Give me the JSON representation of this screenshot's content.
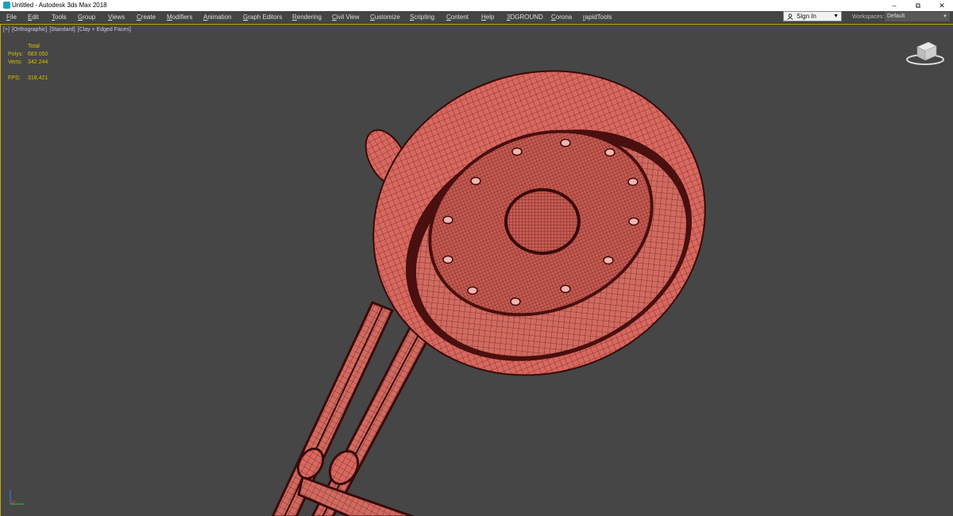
{
  "window": {
    "title": "Untitled - Autodesk 3ds Max 2018",
    "app_icon": "3ds-max-app-icon",
    "controls": [
      "minimize-icon",
      "restore-icon",
      "close-icon"
    ],
    "minimize_glyph": "–",
    "restore_glyph": "⧉",
    "close_glyph": "✕"
  },
  "menu": {
    "items": [
      "File",
      "Edit",
      "Tools",
      "Group",
      "Views",
      "Create",
      "Modifiers",
      "Animation",
      "Graph Editors",
      "Rendering",
      "Civil View",
      "Customize",
      "Scripting",
      "Content",
      "Help",
      "3DGROUND",
      "Corona",
      "rapidTools"
    ]
  },
  "account": {
    "signin_label": "Sign In",
    "workspaces_label": "Workspaces:",
    "workspace_value": "Default"
  },
  "viewport": {
    "label_parts": [
      "[+]",
      "[Orthographic]",
      "[Standard]",
      "[Clay + Edged Faces]"
    ],
    "stats": {
      "header": "Total",
      "polys_label": "Polys:",
      "polys_value": "683 050",
      "verts_label": "Verts:",
      "verts_value": "342 244",
      "fps_label": "FPS:",
      "fps_value": "318,421"
    },
    "colors": {
      "background": "#464646",
      "active_border": "#c8a800",
      "stats_text": "#d6c000",
      "clay_fill": "#d9685f",
      "wire_edges": "#3a0a0a"
    }
  }
}
